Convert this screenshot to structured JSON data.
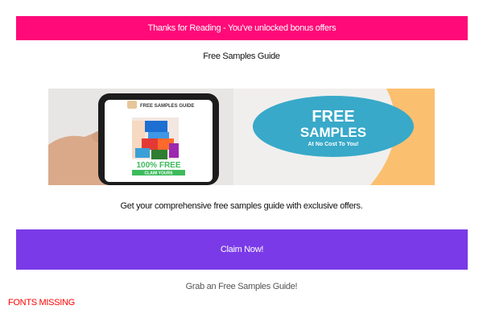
{
  "banner": {
    "text": "Thanks for Reading - You've unlocked bonus offers",
    "color": "#ff0a78"
  },
  "guide": {
    "title": "Free Samples Guide"
  },
  "hero": {
    "badge_line1": "FREE",
    "badge_line2": "SAMPLES",
    "badge_line3": "At No Cost To You!",
    "phone_header": "FREE SAMPLES GUIDE",
    "phone_offer": "100% FREE",
    "phone_cta": "CLAIM YOURS",
    "badge_color": "#38a9c9",
    "accent_color": "#fbbf70"
  },
  "description": {
    "text": "Get your comprehensive free samples guide with exclusive offers."
  },
  "cta": {
    "label": "Claim Now!",
    "color": "#7a3ae8"
  },
  "subtext": {
    "text": "Grab an Free Samples Guide!"
  },
  "warning": {
    "text": "FONTS MISSING",
    "color": "#ff0000"
  }
}
